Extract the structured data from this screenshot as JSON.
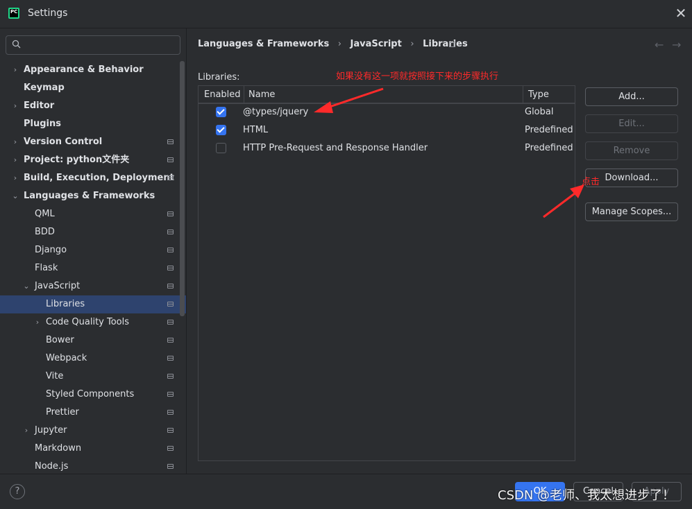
{
  "window": {
    "title": "Settings",
    "logo_text": "PC"
  },
  "search": {
    "placeholder": ""
  },
  "sidebar": {
    "items": [
      {
        "label": "Appearance & Behavior",
        "bold": true,
        "chevron": "›"
      },
      {
        "label": "Keymap",
        "bold": true,
        "chevron": ""
      },
      {
        "label": "Editor",
        "bold": true,
        "chevron": "›"
      },
      {
        "label": "Plugins",
        "bold": true,
        "chevron": ""
      },
      {
        "label": "Version Control",
        "bold": true,
        "chevron": "›"
      },
      {
        "label": "Project: python文件夹",
        "bold": true,
        "chevron": "›"
      },
      {
        "label": "Build, Execution, Deployment",
        "bold": true,
        "chevron": "›"
      },
      {
        "label": "Languages & Frameworks",
        "bold": true,
        "chevron": "⌄"
      },
      {
        "label": "QML",
        "bold": false,
        "chevron": ""
      },
      {
        "label": "BDD",
        "bold": false,
        "chevron": ""
      },
      {
        "label": "Django",
        "bold": false,
        "chevron": ""
      },
      {
        "label": "Flask",
        "bold": false,
        "chevron": ""
      },
      {
        "label": "JavaScript",
        "bold": false,
        "chevron": "⌄"
      },
      {
        "label": "Libraries",
        "bold": false,
        "chevron": ""
      },
      {
        "label": "Code Quality Tools",
        "bold": false,
        "chevron": "›"
      },
      {
        "label": "Bower",
        "bold": false,
        "chevron": ""
      },
      {
        "label": "Webpack",
        "bold": false,
        "chevron": ""
      },
      {
        "label": "Vite",
        "bold": false,
        "chevron": ""
      },
      {
        "label": "Styled Components",
        "bold": false,
        "chevron": ""
      },
      {
        "label": "Prettier",
        "bold": false,
        "chevron": ""
      },
      {
        "label": "Jupyter",
        "bold": false,
        "chevron": "›"
      },
      {
        "label": "Markdown",
        "bold": false,
        "chevron": ""
      },
      {
        "label": "Node.js",
        "bold": false,
        "chevron": ""
      }
    ]
  },
  "breadcrumb": {
    "items": [
      "Languages & Frameworks",
      "JavaScript",
      "Libraries"
    ],
    "separator": "›"
  },
  "libraries": {
    "label": "Libraries:",
    "columns": [
      "Enabled",
      "Name",
      "Type"
    ],
    "rows": [
      {
        "enabled": true,
        "name": "@types/jquery",
        "type": "Global"
      },
      {
        "enabled": true,
        "name": "HTML",
        "type": "Predefined"
      },
      {
        "enabled": false,
        "name": "HTTP Pre-Request and Response Handler",
        "type": "Predefined"
      }
    ]
  },
  "buttons": {
    "add": "Add...",
    "edit": "Edit...",
    "remove": "Remove",
    "download": "Download...",
    "manage_scopes": "Manage Scopes..."
  },
  "annotations": {
    "note1": "如果没有这一项就按照接下来的步骤执行",
    "note2": "点击",
    "color": "#ff2a2a"
  },
  "footer": {
    "help": "?",
    "ok": "OK",
    "cancel": "Cancel",
    "apply": "Apply",
    "watermark": "CSDN @老师、我太想进步了！"
  },
  "colors": {
    "accent": "#3574f0",
    "selection": "#2e436e",
    "background": "#2b2d30"
  }
}
